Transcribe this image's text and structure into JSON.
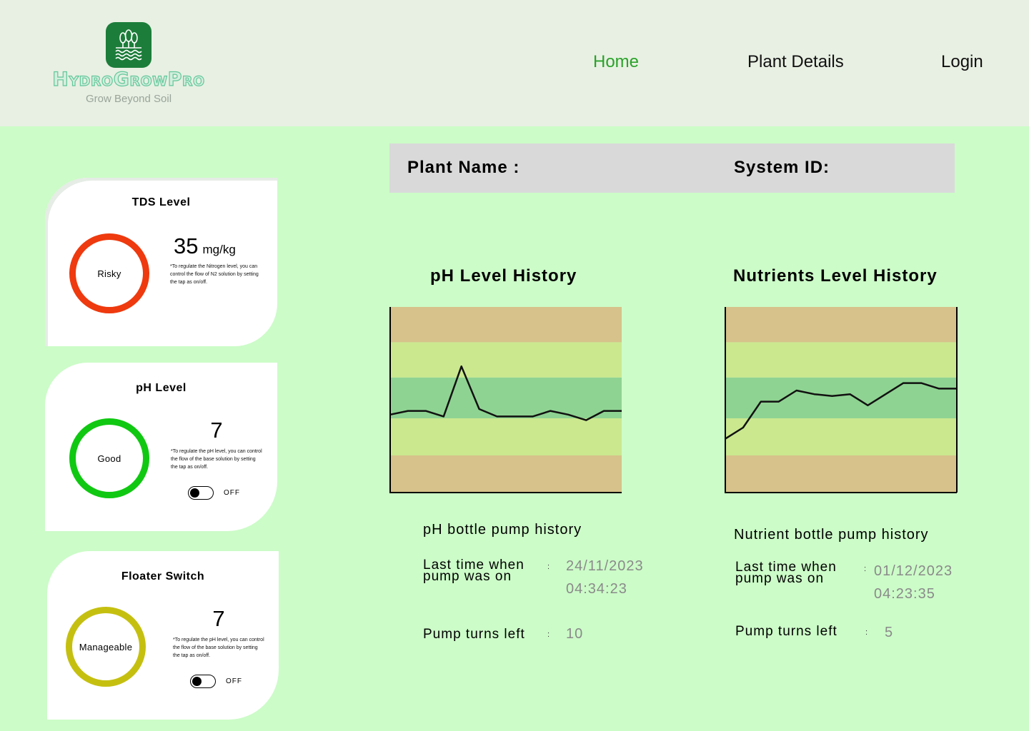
{
  "brand": {
    "name": "HydroGrowPro",
    "tagline": "Grow Beyond Soil",
    "color": "#1c7d3a"
  },
  "nav": {
    "items": [
      {
        "label": "Home",
        "active": true
      },
      {
        "label": "Plant Details",
        "active": false
      },
      {
        "label": "Login",
        "active": false
      }
    ],
    "active_color": "#2aa22a"
  },
  "sensors": {
    "tds": {
      "title": "TDS Level",
      "status": "Risky",
      "status_color": "#ee3a0e",
      "value": "35",
      "unit": "mg/kg",
      "note": "*To regulate the Nitrogen level, you can control the flow of N2 solution by setting the tap as on/off."
    },
    "ph": {
      "title": "pH Level",
      "status": "Good",
      "status_color": "#10c812",
      "value": "7",
      "note": "*To regulate the pH level, you can control the flow of the base solution by setting the tap as on/off.",
      "toggle_state": "OFF"
    },
    "floater": {
      "title": "Floater Switch",
      "status": "Manageable",
      "status_color": "#c5c010",
      "value": "7",
      "note": "*To regulate the pH level, you can control the flow of the base solution by setting the tap as on/off.",
      "toggle_state": "OFF"
    }
  },
  "info_bar": {
    "plant_name_label": "Plant Name :",
    "system_id_label": "System ID:"
  },
  "charts": {
    "ph_title": "pH Level History",
    "nutrients_title": "Nutrients Level History",
    "band_colors": [
      "#d6c28a",
      "#cbe88f",
      "#8fd392"
    ]
  },
  "chart_data": [
    {
      "type": "line",
      "title": "pH Level History",
      "x": [
        0,
        1,
        2,
        3,
        4,
        5,
        6,
        7,
        8,
        9,
        10,
        11,
        12,
        13,
        14
      ],
      "series": [
        {
          "values": [
            0.42,
            0.44,
            0.44,
            0.41,
            0.68,
            0.45,
            0.41,
            0.41,
            0.41,
            0.44,
            0.42,
            0.39,
            0.44,
            0.44
          ]
        }
      ],
      "ylim": [
        0,
        1
      ],
      "bands": [
        0.2,
        0.4,
        0.62,
        0.81
      ],
      "grid": false
    },
    {
      "type": "line",
      "title": "Nutrients Level History",
      "x": [
        0,
        1,
        2,
        3,
        4,
        5,
        6,
        7,
        8,
        9,
        10,
        11,
        12
      ],
      "series": [
        {
          "values": [
            0.29,
            0.35,
            0.49,
            0.49,
            0.55,
            0.53,
            0.52,
            0.53,
            0.47,
            0.53,
            0.59,
            0.59,
            0.56,
            0.56
          ]
        }
      ],
      "ylim": [
        0,
        1
      ],
      "bands": [
        0.2,
        0.4,
        0.62,
        0.81
      ],
      "grid": false
    }
  ],
  "pumps": {
    "ph": {
      "title": "pH bottle pump history",
      "last_on_label": "Last time when pump was on",
      "last_on_date": "24/11/2023",
      "last_on_time": "04:34:23",
      "turns_left_label": "Pump turns left",
      "turns_left": "10"
    },
    "nutrient": {
      "title": "Nutrient bottle pump history",
      "last_on_label": "Last time when pump was on",
      "last_on_date": "01/12/2023",
      "last_on_time": "04:23:35",
      "turns_left_label": "Pump turns left",
      "turns_left": "5"
    }
  }
}
